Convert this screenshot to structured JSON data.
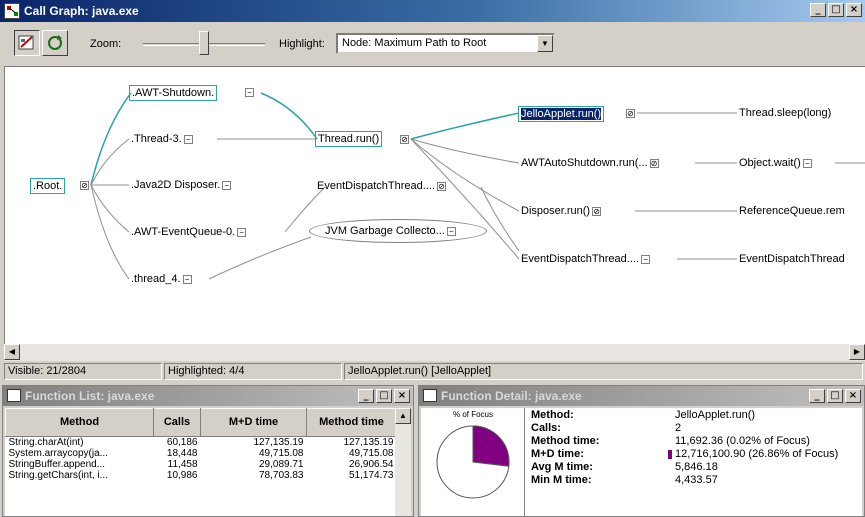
{
  "window": {
    "title": "Call Graph: java.exe",
    "icon": "call-graph-icon",
    "buttons": [
      "_",
      "□",
      "×"
    ]
  },
  "toolbar": {
    "zoom_label": "Zoom:",
    "zoom_level": 0.5,
    "highlight_label": "Highlight:",
    "highlight_value": "Node: Maximum Path to Root"
  },
  "graph": {
    "nodes": {
      "root": ".Root.",
      "awt_shutdown": ".AWT-Shutdown.",
      "thread3": ".Thread-3.",
      "java2d": ".Java2D Disposer.",
      "awt_eventqueue": ".AWT-EventQueue-0.",
      "thread4": ".thread_4.",
      "thread_run": "Thread.run()",
      "edt_mid": "EventDispatchThread....",
      "jvm_gc": "JVM Garbage Collecto...",
      "jello_run": "JelloApplet.run()",
      "awt_auto": "AWTAutoShutdown.run(...",
      "disposer_run": "Disposer.run()",
      "edt_right": "EventDispatchThread....",
      "thread_sleep": "Thread.sleep(long)",
      "object_wait": "Object.wait()",
      "refqueue": "ReferenceQueue.rem",
      "edt_far": "EventDispatchThread"
    }
  },
  "statusbar": {
    "visible": "Visible: 21/2804",
    "highlighted": "Highlighted: 4/4",
    "selection": "JelloApplet.run() [JelloApplet]"
  },
  "function_list": {
    "title": "Function List:  java.exe",
    "columns": [
      "Method",
      "Calls",
      "M+D time",
      "Method time"
    ],
    "rows": [
      [
        "String.charAt(int)",
        "60,186",
        "127,135.19",
        "127,135.19"
      ],
      [
        "System.arraycopy(ja...",
        "18,448",
        "49,715.08",
        "49,715.08"
      ],
      [
        "StringBuffer.append...",
        "11,458",
        "29,089.71",
        "26,906.54"
      ],
      [
        "String.getChars(int, i...",
        "10,986",
        "78,703.83",
        "51,174.73"
      ]
    ]
  },
  "function_detail": {
    "title": "Function Detail:  java.exe",
    "pie_label": "% of Focus",
    "pie_fraction": 0.2686,
    "accent_color": "#800080",
    "fields": [
      {
        "label": "Method:",
        "value": "JelloApplet.run()"
      },
      {
        "label": "Calls:",
        "value": "2"
      },
      {
        "label": "Method time:",
        "value": "11,692.36 (0.02% of Focus)"
      },
      {
        "label": "M+D time:",
        "value": "12,716,100.90 (26.86% of Focus)"
      },
      {
        "label": "Avg M time:",
        "value": "5,846.18"
      },
      {
        "label": "Min M time:",
        "value": "4,433.57"
      }
    ]
  }
}
